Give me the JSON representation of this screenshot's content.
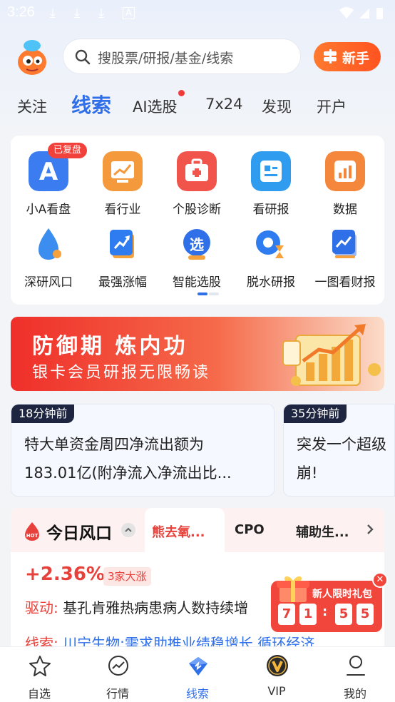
{
  "status_bar": {
    "time": "3:26",
    "extra_icon": "A"
  },
  "search": {
    "placeholder": "搜股票/研报/基金/线索"
  },
  "newbie_button": {
    "label": "新手"
  },
  "tabs": [
    {
      "label": "关注"
    },
    {
      "label": "线索",
      "active": true
    },
    {
      "label": "AI选股",
      "has_dot": true
    },
    {
      "label": "7x24"
    },
    {
      "label": "发现"
    },
    {
      "label": "开户"
    }
  ],
  "grid": {
    "items": [
      {
        "label": "小A看盘",
        "icon": "a-icon",
        "badge": "已复盘"
      },
      {
        "label": "看行业",
        "icon": "trend-chart-icon"
      },
      {
        "label": "个股诊断",
        "icon": "medical-kit-icon"
      },
      {
        "label": "看研报",
        "icon": "report-card-icon"
      },
      {
        "label": "数据",
        "icon": "bar-chart-icon"
      },
      {
        "label": "深研风口",
        "icon": "flame-drop-icon"
      },
      {
        "label": "最强涨幅",
        "icon": "rise-arrow-icon"
      },
      {
        "label": "智能选股",
        "icon": "select-icon",
        "icon_text": "选"
      },
      {
        "label": "脱水研报",
        "icon": "hourglass-icon"
      },
      {
        "label": "一图看财报",
        "icon": "chart-board-icon"
      }
    ]
  },
  "banner": {
    "title": "防御期  炼内功",
    "subtitle": "银卡会员研报无限畅读"
  },
  "news": [
    {
      "time": "18分钟前",
      "line1": "特大单资金周四净流出额为",
      "line2": "183.01亿(附净流入净流出比..."
    },
    {
      "time": "35分钟前",
      "line1": "突发一个超级",
      "line2": "崩!"
    }
  ],
  "hot": {
    "title": "今日风口",
    "tabs": [
      "熊去氧...",
      "CPO",
      "辅助生..."
    ],
    "change": "+2.36%",
    "rise_badge": "3家大涨",
    "drive_label": "驱动:",
    "drive_text": "基孔肯雅热病患病人数持续增",
    "clue_label": "线索:",
    "clue_text": "川宁生物:需求助推业绩稳增长 循环经济..."
  },
  "gift": {
    "title": "新人限时礼包",
    "digits": [
      "7",
      "1",
      "5",
      "5"
    ],
    "colon": ":"
  },
  "bottom_nav": [
    {
      "label": "自选",
      "icon": "star-icon"
    },
    {
      "label": "行情",
      "icon": "market-chart-icon"
    },
    {
      "label": "线索",
      "icon": "diamond-icon",
      "active": true
    },
    {
      "label": "VIP",
      "icon": "vip-icon"
    },
    {
      "label": "我的",
      "icon": "profile-icon"
    }
  ],
  "colors": {
    "accent": "#2f6fe8",
    "red": "#e8403a",
    "orange": "#ff6a2a"
  }
}
